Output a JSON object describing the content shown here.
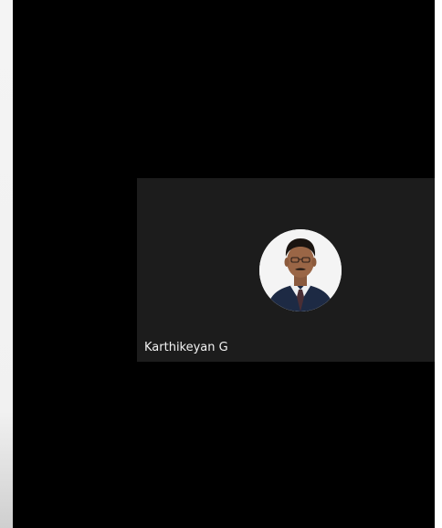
{
  "participant": {
    "name": "Karthikeyan G"
  },
  "colors": {
    "stage_background": "#000000",
    "tile_background": "#1c1c1c",
    "name_text": "#f2f2f2"
  },
  "icons": {
    "avatar": "profile-photo"
  }
}
